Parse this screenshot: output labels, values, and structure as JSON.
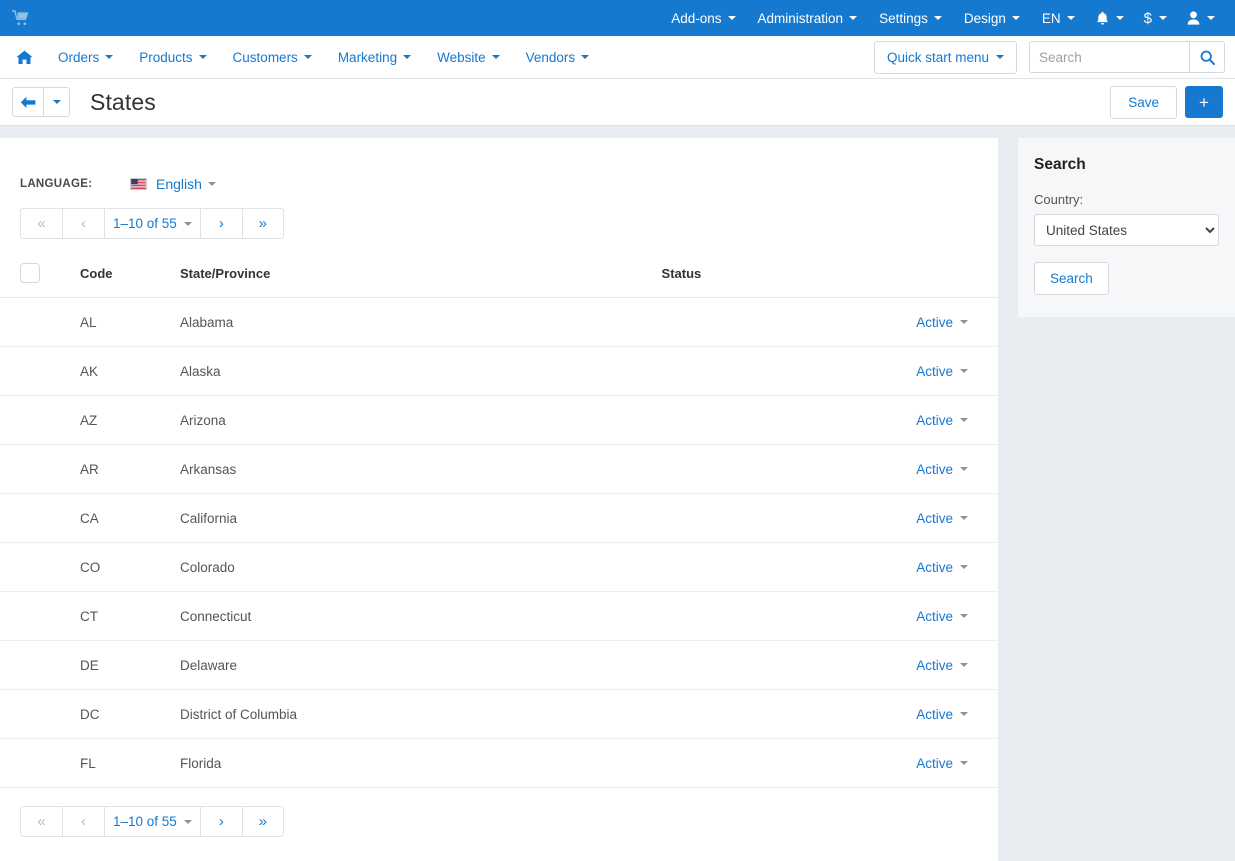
{
  "topbar": {
    "logo_icon": "cart-icon",
    "nav": [
      {
        "label": "Add-ons",
        "has_caret": true
      },
      {
        "label": "Administration",
        "has_caret": true
      },
      {
        "label": "Settings",
        "has_caret": true
      },
      {
        "label": "Design",
        "has_caret": true
      },
      {
        "label": "EN",
        "has_caret": true
      }
    ],
    "icons": [
      {
        "name": "notifications-icon",
        "glyph": "bell"
      },
      {
        "name": "currency-icon",
        "glyph": "$"
      },
      {
        "name": "user-account-icon",
        "glyph": "person"
      }
    ],
    "background_color": "#1579d0"
  },
  "subbar": {
    "home_icon": "home-icon",
    "nav": [
      {
        "label": "Orders"
      },
      {
        "label": "Products"
      },
      {
        "label": "Customers"
      },
      {
        "label": "Marketing"
      },
      {
        "label": "Website"
      },
      {
        "label": "Vendors"
      }
    ],
    "quick_start_label": "Quick start menu",
    "search_placeholder": "Search",
    "search_value": "",
    "search_icon": "search-icon"
  },
  "titlebar": {
    "back_icon": "arrow-left-icon",
    "title": "States",
    "save_label": "Save",
    "add_label": "+"
  },
  "content": {
    "language_label": "LANGUAGE:",
    "language_value": "English",
    "language_flag": "us-flag-icon"
  },
  "pagination": {
    "first_label": "«",
    "prev_label": "‹",
    "range_label": "1–10 of 55",
    "next_label": "›",
    "last_label": "»"
  },
  "table": {
    "columns": {
      "code": "Code",
      "name": "State/Province",
      "status": "Status"
    },
    "rows": [
      {
        "code": "AL",
        "name": "Alabama",
        "status": "Active"
      },
      {
        "code": "AK",
        "name": "Alaska",
        "status": "Active"
      },
      {
        "code": "AZ",
        "name": "Arizona",
        "status": "Active"
      },
      {
        "code": "AR",
        "name": "Arkansas",
        "status": "Active"
      },
      {
        "code": "CA",
        "name": "California",
        "status": "Active"
      },
      {
        "code": "CO",
        "name": "Colorado",
        "status": "Active"
      },
      {
        "code": "CT",
        "name": "Connecticut",
        "status": "Active"
      },
      {
        "code": "DE",
        "name": "Delaware",
        "status": "Active"
      },
      {
        "code": "DC",
        "name": "District of Columbia",
        "status": "Active"
      },
      {
        "code": "FL",
        "name": "Florida",
        "status": "Active"
      }
    ]
  },
  "side_panel": {
    "title": "Search",
    "country_label": "Country:",
    "country_value": "United States",
    "country_options": [
      "United States"
    ],
    "search_button_label": "Search"
  },
  "colors": {
    "accent": "#1579d0",
    "page_background": "#e9edf1",
    "panel_background": "#f6f7f8"
  }
}
